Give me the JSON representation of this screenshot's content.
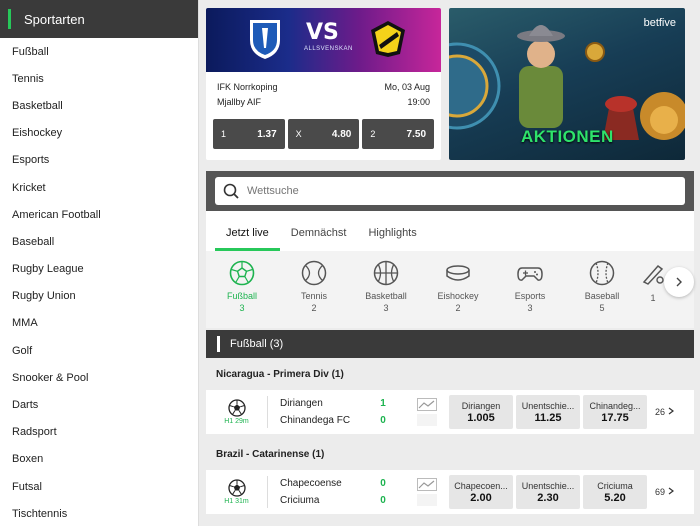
{
  "sidebar": {
    "title": "Sportarten",
    "items": [
      {
        "label": "Fußball"
      },
      {
        "label": "Tennis"
      },
      {
        "label": "Basketball"
      },
      {
        "label": "Eishockey"
      },
      {
        "label": "Esports"
      },
      {
        "label": "Kricket"
      },
      {
        "label": "American Football"
      },
      {
        "label": "Baseball"
      },
      {
        "label": "Rugby League"
      },
      {
        "label": "Rugby Union"
      },
      {
        "label": "MMA"
      },
      {
        "label": "Golf"
      },
      {
        "label": "Snooker & Pool"
      },
      {
        "label": "Darts"
      },
      {
        "label": "Radsport"
      },
      {
        "label": "Boxen"
      },
      {
        "label": "Futsal"
      },
      {
        "label": "Tischtennis"
      }
    ]
  },
  "featured_match": {
    "vs": "VS",
    "league": "ALLSVENSKAN",
    "home": "IFK Norrkoping",
    "away": "Mjallby AIF",
    "date": "Mo, 03 Aug",
    "time": "19:00",
    "odds": [
      {
        "label": "1",
        "value": "1.37"
      },
      {
        "label": "X",
        "value": "4.80"
      },
      {
        "label": "2",
        "value": "7.50"
      }
    ]
  },
  "promo": {
    "brand": "betfive",
    "title": "AKTIONEN"
  },
  "search": {
    "placeholder": "Wettsuche"
  },
  "tabs": [
    {
      "label": "Jetzt live"
    },
    {
      "label": "Demnächst"
    },
    {
      "label": "Highlights"
    }
  ],
  "sports_strip": [
    {
      "name": "Fußball",
      "count": "3",
      "icon": "football-icon"
    },
    {
      "name": "Tennis",
      "count": "2",
      "icon": "tennis-icon"
    },
    {
      "name": "Basketball",
      "count": "3",
      "icon": "basketball-icon"
    },
    {
      "name": "Eishockey",
      "count": "2",
      "icon": "hockey-puck-icon"
    },
    {
      "name": "Esports",
      "count": "3",
      "icon": "gamepad-icon"
    },
    {
      "name": "Baseball",
      "count": "5",
      "icon": "baseball-icon"
    },
    {
      "name": "",
      "count": "1",
      "icon": "cricket-icon"
    }
  ],
  "section": {
    "title": "Fußball",
    "count": "(3)"
  },
  "leagues": [
    {
      "name": "Nicaragua - Primera Div (1)",
      "event": {
        "time": "H1 29m",
        "home": "Diriangen",
        "away": "Chinandega FC",
        "home_score": "1",
        "away_score": "0",
        "odds": [
          {
            "label": "Diriangen",
            "value": "1.005"
          },
          {
            "label": "Unentschie...",
            "value": "11.25"
          },
          {
            "label": "Chinandeg...",
            "value": "17.75"
          }
        ],
        "more": "26"
      }
    },
    {
      "name": "Brazil - Catarinense (1)",
      "event": {
        "time": "H1 31m",
        "home": "Chapecoense",
        "away": "Criciuma",
        "home_score": "0",
        "away_score": "0",
        "odds": [
          {
            "label": "Chapecoen...",
            "value": "2.00"
          },
          {
            "label": "Unentschie...",
            "value": "2.30"
          },
          {
            "label": "Criciuma",
            "value": "5.20"
          }
        ],
        "more": "69"
      }
    }
  ],
  "colors": {
    "accent": "#27c85a",
    "dark_header": "#3a3a3a",
    "odd_button_dark": "#4a4a4a"
  }
}
